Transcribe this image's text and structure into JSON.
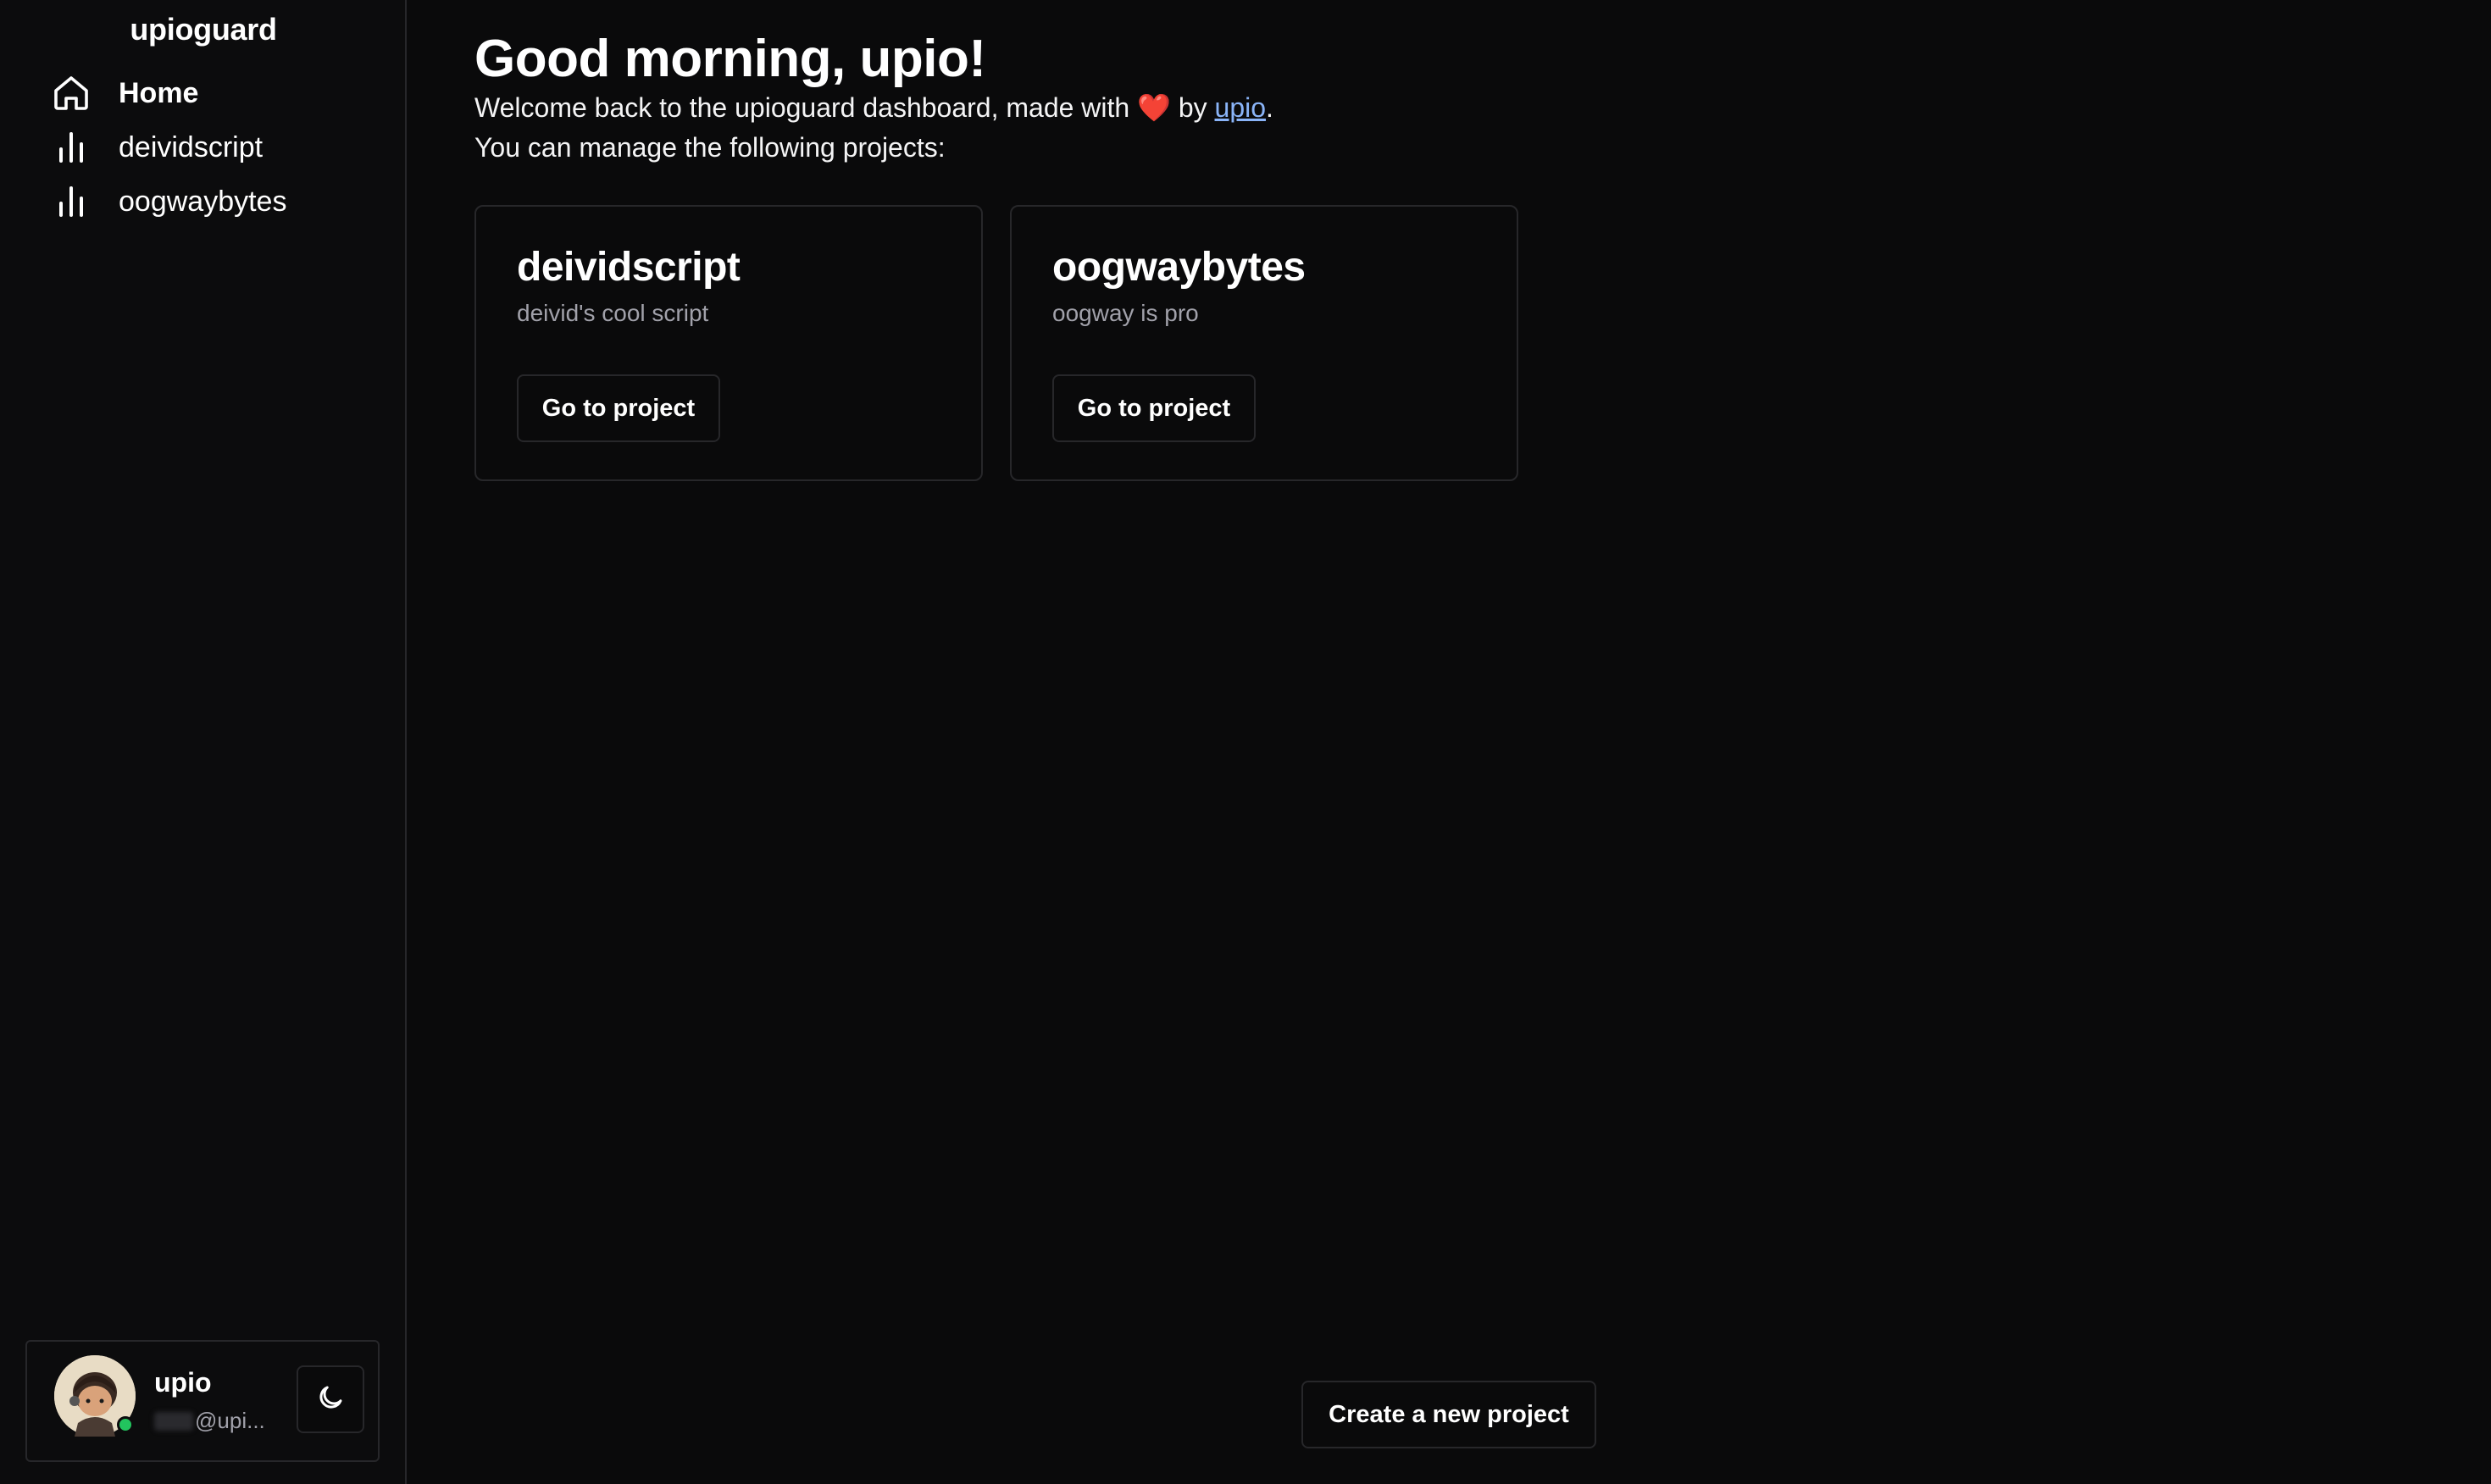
{
  "app": {
    "brand": "upioguard"
  },
  "sidebar": {
    "items": [
      {
        "label": "Home",
        "icon": "home-icon",
        "active": true
      },
      {
        "label": "deividscript",
        "icon": "bar-chart-icon",
        "active": false
      },
      {
        "label": "oogwaybytes",
        "icon": "bar-chart-icon",
        "active": false
      }
    ],
    "user": {
      "name": "upio",
      "handle": "@upi...",
      "status": "online",
      "status_color": "#22c55e"
    },
    "theme_toggle_icon": "moon-icon"
  },
  "main": {
    "greeting": "Good morning, upio!",
    "welcome_prefix": "Welcome back to the upioguard dashboard, made with",
    "heart": "❤️",
    "welcome_by": "by",
    "author_link": "upio",
    "welcome_suffix": ".",
    "projects_intro": "You can manage the following projects:",
    "projects": [
      {
        "title": "deividscript",
        "description": "deivid's cool script",
        "button": "Go to project"
      },
      {
        "title": "oogwaybytes",
        "description": "oogway is pro",
        "button": "Go to project"
      }
    ],
    "create_button": "Create a new project"
  },
  "colors": {
    "background": "#0a0a0b",
    "border": "#27272a",
    "link": "#8ab4f8",
    "muted_text": "#a1a1aa"
  }
}
